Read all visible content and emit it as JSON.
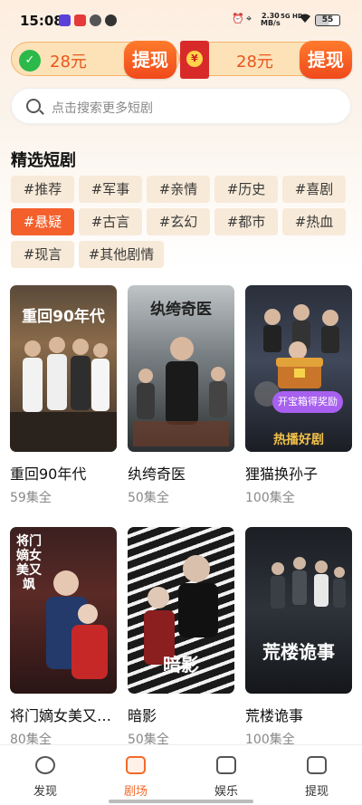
{
  "status_bar": {
    "time": "15:08",
    "net_speed_value": "2.30",
    "net_speed_unit": "MB/s",
    "signal": "5G HD",
    "battery": "55"
  },
  "reward_bar": {
    "left_amount": "28元",
    "left_button": "提现",
    "right_amount": "28元",
    "right_button": "提现",
    "accent_color": "#f0491c"
  },
  "search": {
    "placeholder": "点击搜索更多短剧"
  },
  "section": {
    "title": "精选短剧"
  },
  "tags": [
    {
      "label": "#推荐",
      "active": false
    },
    {
      "label": "#军事",
      "active": false
    },
    {
      "label": "#亲情",
      "active": false
    },
    {
      "label": "#历史",
      "active": false
    },
    {
      "label": "#喜剧",
      "active": false
    },
    {
      "label": "#悬疑",
      "active": true
    },
    {
      "label": "#古言",
      "active": false
    },
    {
      "label": "#玄幻",
      "active": false
    },
    {
      "label": "#都市",
      "active": false
    },
    {
      "label": "#热血",
      "active": false
    },
    {
      "label": "#现言",
      "active": false
    },
    {
      "label": "#其他剧情",
      "active": false
    }
  ],
  "dramas": [
    {
      "title": "重回90年代",
      "episodes": "59集全",
      "poster_text": "重回90年代"
    },
    {
      "title": "纨绔奇医",
      "episodes": "50集全",
      "poster_text": "纨绔奇医"
    },
    {
      "title": "狸猫换孙子",
      "episodes": "100集全",
      "poster_text": "热播好剧",
      "badge": "开宝箱得奖励"
    },
    {
      "title": "将门嫡女美又…",
      "episodes": "80集全",
      "poster_text": "将门嫡女美又飒"
    },
    {
      "title": "暗影",
      "episodes": "50集全",
      "poster_text": "暗影"
    },
    {
      "title": "荒楼诡事",
      "episodes": "100集全",
      "poster_text": "荒楼诡事"
    }
  ],
  "tab_bar": {
    "tabs": [
      {
        "label": "发现",
        "icon": "discover-icon",
        "active": false
      },
      {
        "label": "剧场",
        "icon": "theater-icon",
        "active": true
      },
      {
        "label": "娱乐",
        "icon": "entertainment-icon",
        "active": false
      },
      {
        "label": "提现",
        "icon": "withdraw-icon",
        "active": false
      }
    ],
    "active_color": "#f26a2b"
  }
}
